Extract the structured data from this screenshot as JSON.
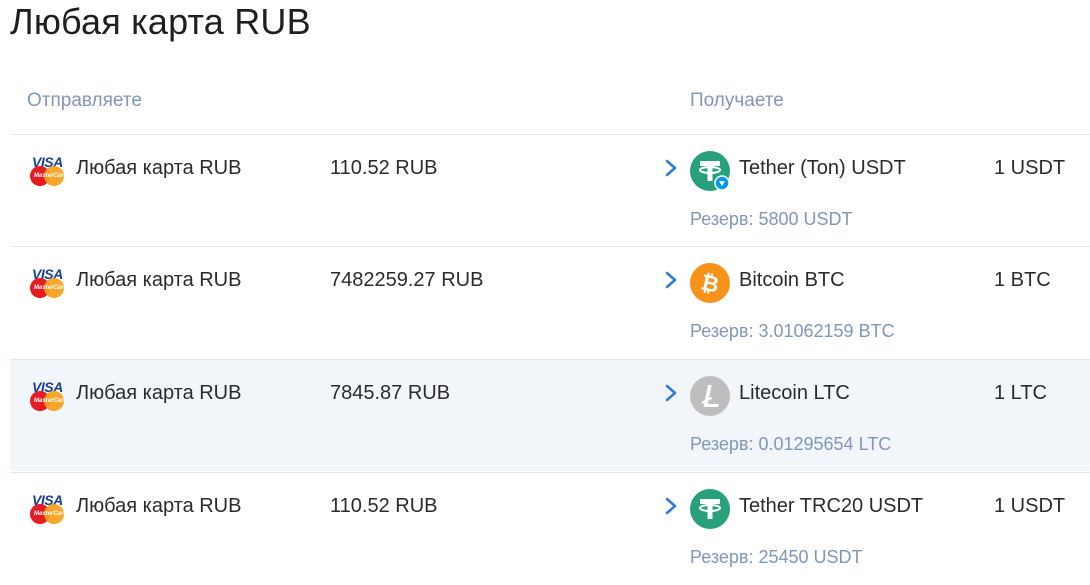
{
  "page": {
    "title": "Любая карта RUB"
  },
  "headers": {
    "send": "Отправляете",
    "receive": "Получаете"
  },
  "brand": {
    "visa": "VISA",
    "mastercard": "MasterCard"
  },
  "rows": [
    {
      "send_name": "Любая карта RUB",
      "send_amount": "110.52 RUB",
      "recv_name": "Tether (Ton) USDT",
      "recv_amount": "1 USDT",
      "reserve": "Резерв: 5800 USDT",
      "icon": "tether-ton-icon",
      "highlighted": false
    },
    {
      "send_name": "Любая карта RUB",
      "send_amount": "7482259.27 RUB",
      "recv_name": "Bitcoin BTC",
      "recv_amount": "1 BTC",
      "reserve": "Резерв: 3.01062159 BTC",
      "icon": "bitcoin-icon",
      "highlighted": false
    },
    {
      "send_name": "Любая карта RUB",
      "send_amount": "7845.87 RUB",
      "recv_name": "Litecoin LTC",
      "recv_amount": "1 LTC",
      "reserve": "Резерв: 0.01295654 LTC",
      "icon": "litecoin-icon",
      "highlighted": true
    },
    {
      "send_name": "Любая карта RUB",
      "send_amount": "110.52 RUB",
      "recv_name": "Tether TRC20 USDT",
      "recv_amount": "1 USDT",
      "reserve": "Резерв: 25450 USDT",
      "icon": "tether-icon",
      "highlighted": false
    }
  ],
  "colors": {
    "tether": "#26a17b",
    "bitcoin": "#f7931a",
    "litecoin": "#bebebe",
    "accent_label": "#7f97b8",
    "arrow": "#2a7bd8",
    "highlight_row": "#f2f6fb"
  }
}
